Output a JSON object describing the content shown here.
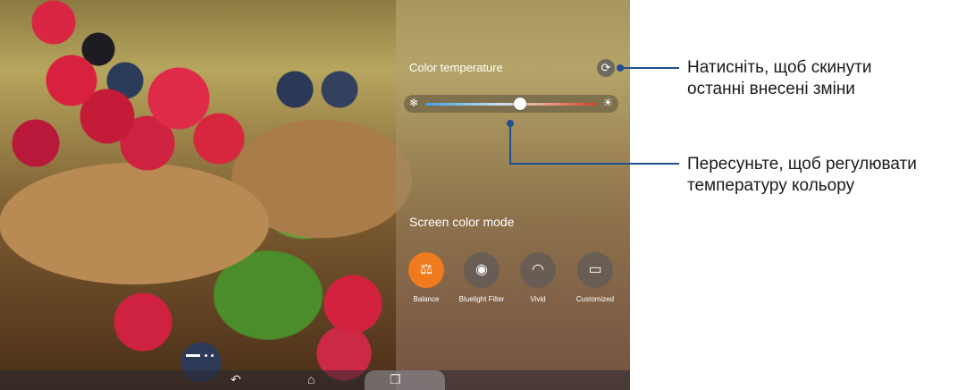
{
  "panel": {
    "color_temperature_label": "Color temperature",
    "reset_icon": "refresh-icon",
    "slider": {
      "cold_icon": "snowflake-icon",
      "warm_icon": "sun-icon",
      "value": 0.55
    },
    "screen_color_mode_label": "Screen color mode",
    "modes": [
      {
        "label": "Balance",
        "icon": "balance-icon",
        "active": true
      },
      {
        "label": "Bluelight Filter",
        "icon": "eye-filter-icon",
        "active": false
      },
      {
        "label": "Vivid",
        "icon": "rainbow-icon",
        "active": false
      },
      {
        "label": "Customized",
        "icon": "customize-icon",
        "active": false
      }
    ]
  },
  "navbar": {
    "back_icon": "back-icon",
    "home_icon": "home-icon",
    "recents_icon": "recents-icon"
  },
  "callouts": {
    "reset": {
      "line1": "Натисніть, щоб скинути",
      "line2": "останні внесені зміни"
    },
    "slider": {
      "line1": "Пересуньте, щоб регулювати",
      "line2": "температуру кольору"
    }
  },
  "colors": {
    "accent": "#f07b1f",
    "callout_line": "#1f4f8e"
  }
}
